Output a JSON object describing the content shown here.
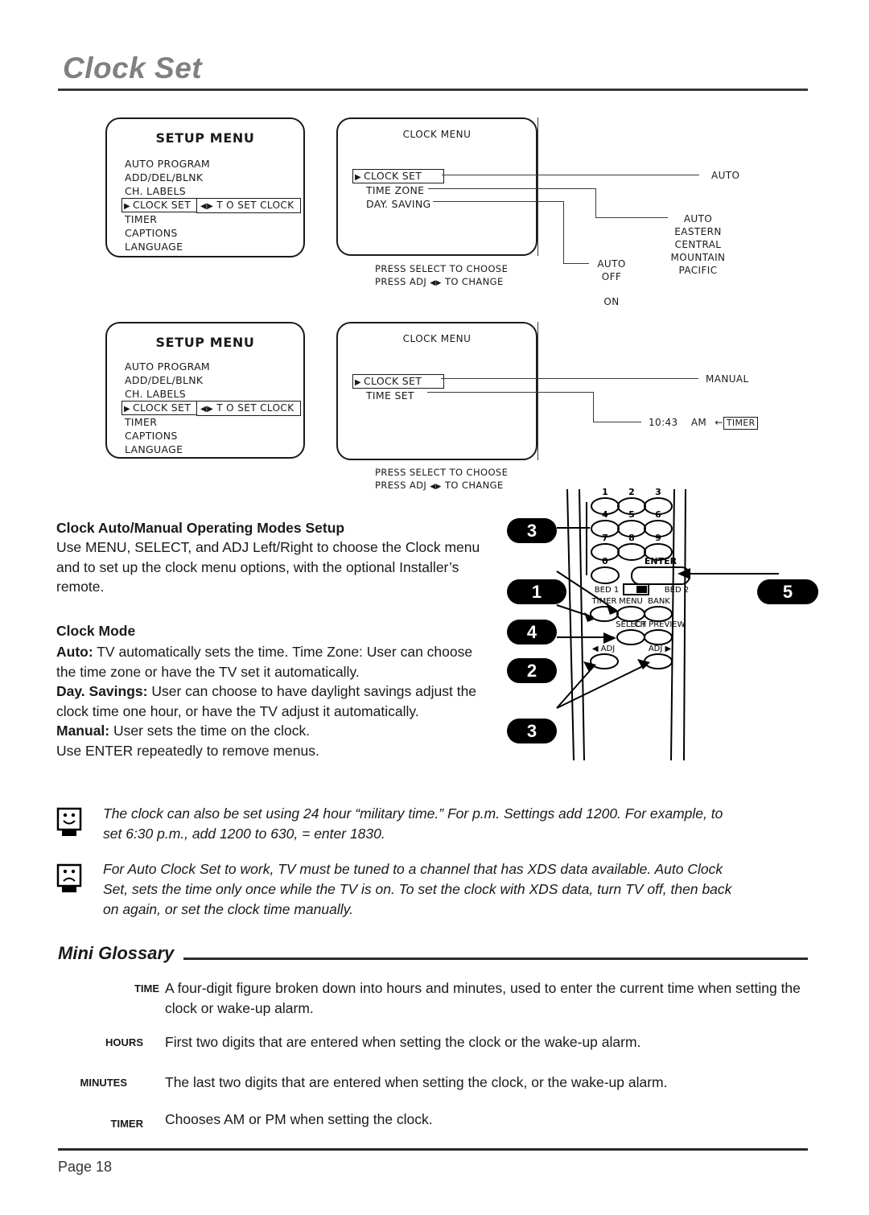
{
  "page": {
    "title": "Clock Set",
    "footer_label": "Page 18"
  },
  "diagram_top": {
    "setup_menu": {
      "title": "SETUP MENU",
      "items": [
        "AUTO PROGRAM",
        "ADD/DEL/BLNK",
        "CH. LABELS",
        "CLOCK SET",
        "TIMER",
        "CAPTIONS",
        "LANGUAGE"
      ],
      "selected_item": "CLOCK SET",
      "hint": "T O SET  CLOCK",
      "hint_arrows": "◀▶"
    },
    "clock_menu": {
      "title": "CLOCK MENU",
      "items": [
        "CLOCK SET",
        "TIME ZONE",
        "DAY. SAVING"
      ],
      "selected_item": "CLOCK SET"
    },
    "press_note_line1": "PRESS SELECT TO CHOOSE",
    "press_note_line2_pre": "PRESS ADJ",
    "press_note_arrows": "◀▶",
    "press_note_line2_post": "TO CHANGE",
    "values": {
      "clock_set": "AUTO",
      "time_zone": [
        "AUTO",
        "EASTERN",
        "CENTRAL",
        "MOUNTAIN",
        "PACIFIC"
      ],
      "day_saving": [
        "AUTO",
        "OFF",
        "ON"
      ]
    }
  },
  "diagram_bottom": {
    "setup_menu": {
      "title": "SETUP MENU",
      "items": [
        "AUTO PROGRAM",
        "ADD/DEL/BLNK",
        "CH. LABELS",
        "CLOCK SET",
        "TIMER",
        "CAPTIONS",
        "LANGUAGE"
      ],
      "selected_item": "CLOCK SET",
      "hint": "T O SET  CLOCK",
      "hint_arrows": "◀▶"
    },
    "clock_menu": {
      "title": "CLOCK MENU",
      "items": [
        "CLOCK SET",
        "TIME SET"
      ],
      "selected_item": "CLOCK SET"
    },
    "press_note_line1": "PRESS SELECT TO CHOOSE",
    "press_note_line2_pre": "PRESS ADJ",
    "press_note_arrows": "◀▶",
    "press_note_line2_post": "TO CHANGE",
    "values": {
      "clock_set": "MANUAL",
      "time_value": "10:43",
      "meridiem": "AM",
      "timer_arrow": "←",
      "timer_chip": "TIMER"
    }
  },
  "body": {
    "heading1": "Clock Auto/Manual Operating Modes Setup",
    "paragraph1": "Use MENU, SELECT, and ADJ Left/Right to choose the Clock menu and to set up the clock menu options, with the optional Installer’s remote.",
    "heading2": "Clock Mode",
    "modes": [
      {
        "term": "Auto:",
        "text": " TV automatically sets the time. Time Zone: User can choose the time zone or have the TV set it automatically."
      },
      {
        "term": "Day. Savings:",
        "text": " User can choose to have daylight savings adjust the clock time one hour, or have the TV adjust it automatically."
      },
      {
        "term": "Manual:",
        "text": " User sets the time on the clock."
      }
    ],
    "closing_line": "Use ENTER repeatedly to remove menus."
  },
  "remote": {
    "keypad": [
      "1",
      "2",
      "3",
      "4",
      "5",
      "6",
      "7",
      "8",
      "9",
      "0"
    ],
    "enter_label": "ENTER",
    "bed1_label": "BED 1",
    "bed2_label": "BED 2",
    "timer_label": "TIMER",
    "menu_label": "MENU",
    "bank_label": "BANK",
    "select_label": "SELECT",
    "ch_preview_label": "CH PREVIEW",
    "adj_left_label": "◀ ADJ",
    "adj_right_label": "ADJ ▶",
    "callouts": [
      {
        "number": "3",
        "target": "keypad"
      },
      {
        "number": "1",
        "target": "menu"
      },
      {
        "number": "4",
        "target": "timer"
      },
      {
        "number": "2",
        "target": "select"
      },
      {
        "number": "3",
        "target": "adj"
      },
      {
        "number": "5",
        "target": "enter"
      }
    ]
  },
  "notes": [
    {
      "icon": "smiley-face-icon",
      "text": "The clock can also be set using 24 hour “military time.” For p.m. Settings add 1200. For example, to set 6:30 p.m., add 1200 to 630, = enter 1830."
    },
    {
      "icon": "frowny-face-icon",
      "text": " For Auto Clock Set to work, TV must be tuned to a channel that has XDS data available. Auto Clock Set, sets the time only once while the TV is on. To set the clock with XDS data, turn TV off, then back on again, or set the clock time manually."
    }
  ],
  "glossary": {
    "title": "Mini Glossary",
    "entries": [
      {
        "term": "TIME",
        "definition": "A four-digit figure broken down into hours and minutes, used to enter the current time when setting the clock or wake-up alarm."
      },
      {
        "term": "HOURS",
        "definition": "First two digits that are entered when setting the clock or the wake-up alarm."
      },
      {
        "term": "MINUTES",
        "definition": "The last two digits that are entered when setting the clock, or the wake-up alarm."
      },
      {
        "term": "TIMER",
        "definition": "Chooses AM or PM when setting the clock."
      }
    ]
  },
  "colors": {
    "title_gray": "#808080",
    "ink": "#1a1a1a",
    "callout_bg": "#000000"
  }
}
